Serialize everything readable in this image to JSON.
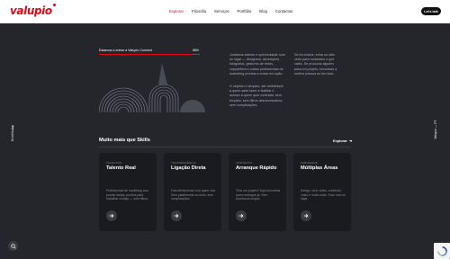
{
  "header": {
    "logo": "valupio",
    "nav": [
      "Explorar",
      "Filosofia",
      "Serviços",
      "Portfólio",
      "Blog",
      "Contactos"
    ],
    "active_index": 0,
    "cta": "Let's talk"
  },
  "side": {
    "left_text": "Scroll to top",
    "right_text": "Valupio — PT"
  },
  "progress": {
    "label": "Estamos a entrar a Valupio Connect",
    "percent_label": "58%",
    "value": 0.92
  },
  "intro": {
    "p1": "Juntamos talento e oportunidade num só lugar — designers, developers, fotógrafos, gestores de redes, copywriters e outros profissionais de marketing prontos a entrar em ação.",
    "p2": "O objetivo é simples: dar visibilidade a quem sabe fazer e facilitar o acesso a quem quer contratar, sem fricções, sem filtros desnecessários, sem complicações.",
    "p3": "Se és criador, entra no sítio certo para mostrares o que vales. Se procuras alguém para um projeto, encontras a melhor pessoa ao teu lado."
  },
  "skills": {
    "title": "Muito mais que Skills",
    "explore": "Explorar",
    "cards": [
      {
        "category": "TALENTOS",
        "title": "Talento Real",
        "desc": "Profissionais de marketing com provas dadas, prontos para trabalhar contigo — sem filtros."
      },
      {
        "category": "TRANSPARÊNCIA",
        "title": "Ligação Direta",
        "desc": "Fala diretamente com quem cria. Sem plataformas no meio, sem complicações."
      },
      {
        "category": "CONTACTO",
        "title": "Arranque Rápido",
        "desc": "Tens um projeto? Aqui encontras quem entregue já. Sem processos longos."
      },
      {
        "category": "VARIEDADE",
        "title": "Múltiplas Áreas",
        "desc": "Design, web, redes, conteúdo, vídeo e muito mais. Tudo num só lugar."
      }
    ]
  },
  "colors": {
    "accent": "#e30613",
    "background": "#24262c",
    "card": "#1a1b1f"
  },
  "icons": {
    "card_button": "arrow-right-icon",
    "fab": "search-icon",
    "captcha": "recaptcha-icon"
  }
}
